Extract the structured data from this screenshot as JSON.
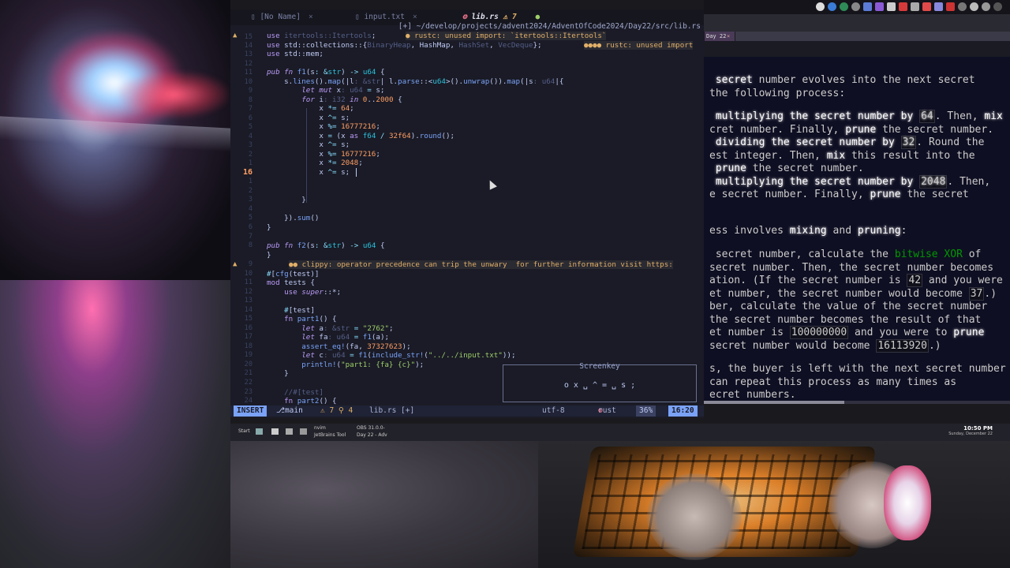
{
  "editor": {
    "tabs": [
      {
        "label": "[No Name]",
        "close": "×"
      },
      {
        "label": "input.txt",
        "close": "×"
      },
      {
        "label": "lib.rs",
        "badge": "⚠ 7"
      }
    ],
    "path": "[+] ~/develop/projects/advent2024/AdventOfCode2024/Day22/src/lib.rs",
    "diagnostics": {
      "unused_import": "rustc: unused import: `itertools::Itertools`",
      "unused_import2": "rustc: unused import",
      "clippy": "clippy: operator precedence can trip the unwary  for further information visit https:"
    },
    "line_numbers": [
      "15",
      "14",
      "13",
      "12",
      "11",
      "10",
      "9",
      "8",
      "7",
      "6",
      "5",
      "4",
      "3",
      "2",
      "1",
      "16",
      "1",
      "2",
      "3",
      "4",
      "5",
      "6",
      "7",
      "8",
      "9",
      "10",
      "11",
      "12",
      "13",
      "14",
      "15",
      "16",
      "17",
      "18",
      "19",
      "20",
      "21",
      "22",
      "23",
      "24"
    ],
    "code": [
      "use itertools::Itertools;",
      "use std::collections::{BinaryHeap, HashMap, HashSet, VecDeque};",
      "use std::mem;",
      "",
      "pub fn f1(s: &str) -> u64 {",
      "    s.lines().map(|l: &str| l.parse::<u64>().unwrap()).map(|s: u64|{",
      "        let mut x: u64 = s;",
      "        for i: i32 in 0..2000 {",
      "            x *= 64;",
      "            x ^= s;",
      "            x %= 16777216;",
      "            x = (x as f64 / 32f64).round();",
      "            x ^= s;",
      "            x %= 16777216;",
      "            x *= 2048;",
      "            x ^= s;",
      "",
      "        }",
      "",
      "    }).sum()",
      "}",
      "",
      "pub fn f2(s: &str) -> u64 {",
      "}",
      "",
      "#[cfg(test)]",
      "mod tests {",
      "    use super::*;",
      "",
      "    #[test]",
      "    fn part1() {",
      "        let a: &str = \"2762\";",
      "        let fa: u64 = f1(a);",
      "        assert_eq!(fa, 37327623);",
      "        let c: u64 = f1(include_str!(\"../../input.txt\"));",
      "        println!(\"part1: {fa} {c}\");",
      "    }",
      "",
      "    //#[test]",
      "    fn part2() {"
    ],
    "screenkey": {
      "title": "Screenkey",
      "keys": "o x ␣ ^ = ␣ s ;"
    },
    "status": {
      "mode": "INSERT",
      "branch": "main",
      "diag": "⚠ 7  ⚲ 4",
      "file": "lib.rs [+]",
      "encoding": "utf-8",
      "ft": "rust",
      "percent": "36%",
      "position": "16:20"
    }
  },
  "aoc": {
    "lines": [
      "secret number evolves into the next secret",
      "the following process:",
      "multiplying the secret number by 64. Then, mix",
      "cret number. Finally, prune the secret number.",
      "dividing the secret number by 32. Round the",
      "est integer. Then, mix this result into the",
      "prune the secret number.",
      "multiplying the secret number by 2048. Then,",
      "e secret number. Finally, prune the secret",
      "ess involves mixing and pruning:",
      "secret number, calculate the bitwise XOR of",
      "secret number. Then, the secret number becomes",
      "ation. (If the secret number is 42 and you were",
      "et number, the secret number would become 37.)",
      "ber, calculate the value of the secret number",
      "the secret number becomes the result of that",
      "et number is 100000000 and you were to prune",
      "secret number would become 16113920.)",
      "s, the buyer is left with the next secret number",
      "can repeat this process as many times as",
      "ecret numbers."
    ]
  },
  "taskbar": {
    "start": "Start",
    "items": [
      "nvim",
      "OBS 31.0.0-",
      "JetBrains Tool",
      "Day 22 - Adv"
    ],
    "time": "10:50 PM",
    "date": "Sunday, December 22"
  },
  "browser": {
    "tab": "Day 22"
  }
}
